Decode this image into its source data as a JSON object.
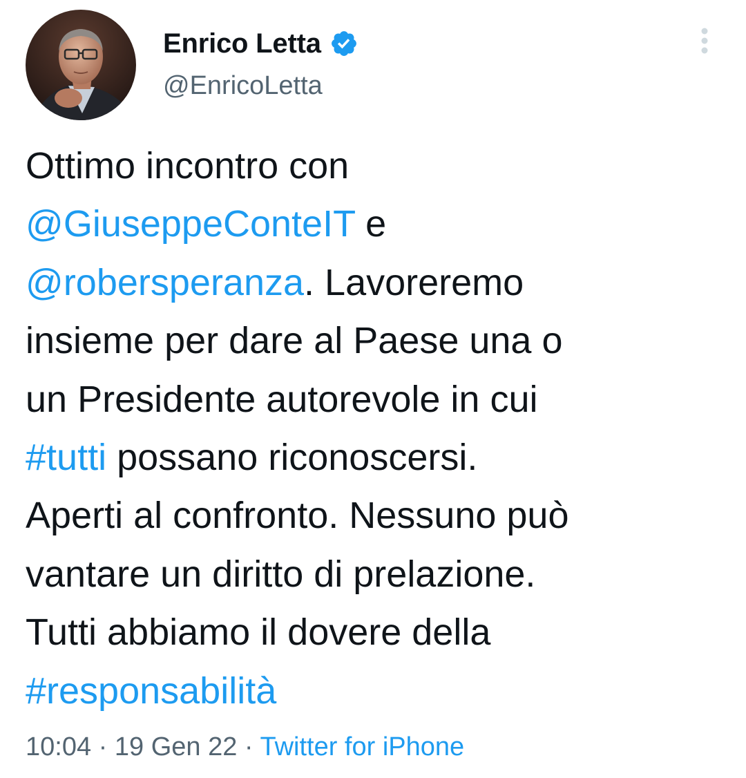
{
  "author": {
    "display_name": "Enrico Letta",
    "handle": "@EnricoLetta",
    "verified": true,
    "verified_icon": "verified-badge-icon",
    "avatar_icon": "profile-photo"
  },
  "menu_icon": "more-vertical-icon",
  "tweet": {
    "line1": {
      "t1": "Ottimo incontro con"
    },
    "line2": {
      "mention": "@GiuseppeConteIT",
      "t1": " e"
    },
    "line3": {
      "mention": "@robersperanza",
      "t1": ". Lavoreremo"
    },
    "line4": {
      "t1": "insieme per dare al Paese una o"
    },
    "line5": {
      "t1": "un Presidente autorevole in cui"
    },
    "line6": {
      "hashtag": "#tutti",
      "t1": " possano riconoscersi."
    },
    "line7": {
      "t1": "Aperti al confronto. Nessuno può"
    },
    "line8": {
      "t1": "vantare un diritto di prelazione."
    },
    "line9": {
      "t1": "Tutti abbiamo il dovere della"
    },
    "line10": {
      "hashtag": "#responsabilità"
    }
  },
  "meta": {
    "time": "10:04",
    "separator": " · ",
    "date": "19 Gen 22",
    "source": "Twitter for iPhone"
  },
  "colors": {
    "link": "#1d9bf0",
    "text": "#0f1419",
    "secondary": "#536471"
  }
}
